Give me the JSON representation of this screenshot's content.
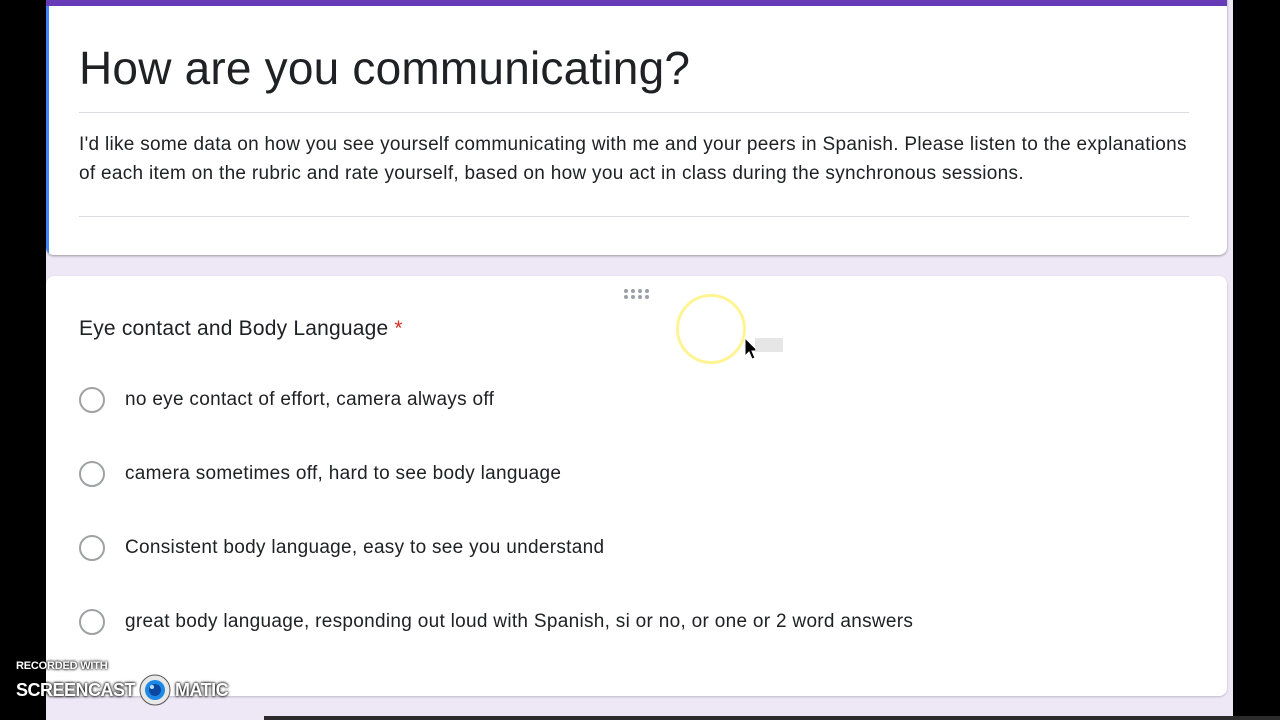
{
  "form": {
    "title": "How are you communicating?",
    "description": "I'd like some data on how you see yourself communicating with me and your peers in Spanish. Please listen to the explanations of each item on the rubric and rate yourself, based on how you act in class during the synchronous sessions.",
    "accent_color": "#673ab7",
    "background_color": "#ede7f6"
  },
  "question": {
    "title": "Eye contact and Body Language",
    "required_marker": "*",
    "options": [
      {
        "label": "no eye contact of effort, camera always off"
      },
      {
        "label": "camera sometimes off, hard to see body language"
      },
      {
        "label": "Consistent body language, easy to see you understand"
      },
      {
        "label": "great body language, responding out loud with Spanish, si or no, or one or 2 word answers"
      }
    ]
  },
  "watermark": {
    "line1": "RECORDED WITH",
    "word_left": "SCREENCAST",
    "word_right": "MATIC"
  }
}
